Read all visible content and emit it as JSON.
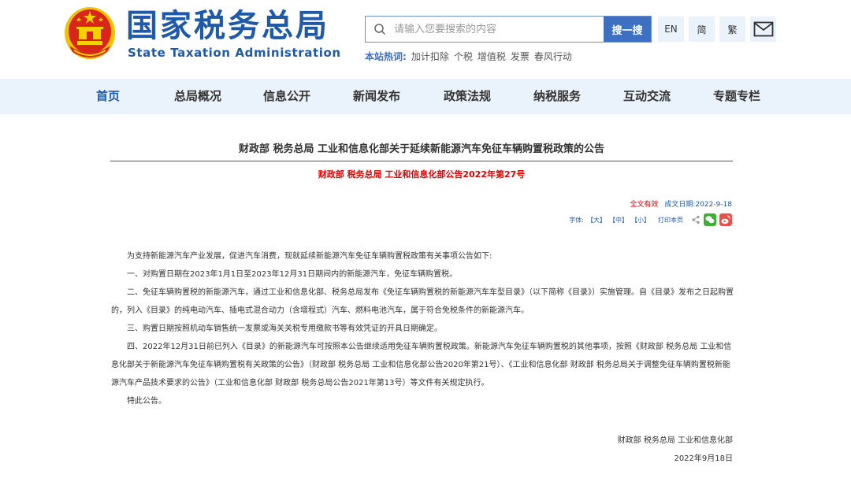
{
  "header": {
    "logo_cn": "国家税务总局",
    "logo_en": "State Taxation Administration",
    "search_placeholder": "请输入您要搜索的内容",
    "search_button": "搜一搜",
    "lang_en": "EN",
    "lang_simplified": "简",
    "lang_traditional": "繁",
    "hot_label": "本站热词:",
    "hot_words": [
      "加计扣除",
      "个税",
      "增值税",
      "发票",
      "春风行动"
    ]
  },
  "nav": {
    "items": [
      "首页",
      "总局概况",
      "信息公开",
      "新闻发布",
      "政策法规",
      "纳税服务",
      "互动交流",
      "专题专栏"
    ],
    "active": "首页"
  },
  "article": {
    "title": "财政部 税务总局 工业和信息化部关于延续新能源汽车免征车辆购置税政策的公告",
    "doc_number": "财政部 税务总局 工业和信息化部公告2022年第27号",
    "validity": "全文有效",
    "date_label": "成文日期:2022-9-18",
    "tools": {
      "font_label": "字体:",
      "font_large": "【大】",
      "font_medium": "【中】",
      "font_small": "【小】",
      "print": "打印本页"
    },
    "paragraphs": [
      "为支持新能源汽车产业发展，促进汽车消费，现就延续新能源汽车免征车辆购置税政策有关事项公告如下:",
      "一、对购置日期在2023年1月1日至2023年12月31日期间内的新能源汽车，免征车辆购置税。",
      "二、免征车辆购置税的新能源汽车，通过工业和信息化部、税务总局发布《免征车辆购置税的新能源汽车车型目录》（以下简称《目录》）实施管理。自《目录》发布之日起购置的，列入《目录》的纯电动汽车、插电式混合动力（含增程式）汽车、燃料电池汽车，属于符合免税条件的新能源汽车。",
      "三、购置日期按照机动车销售统一发票或海关关税专用缴款书等有效凭证的开具日期确定。",
      "四、2022年12月31日前已列入《目录》的新能源汽车可按照本公告继续适用免征车辆购置税政策。新能源汽车免征车辆购置税的其他事项，按照《财政部 税务总局 工业和信息化部关于新能源汽车免征车辆购置税有关政策的公告》（财政部 税务总局 工业和信息化部公告2020年第21号）、《工业和信息化部 财政部 税务总局关于调整免征车辆购置税新能源汽车产品技术要求的公告》（工业和信息化部 财政部 税务总局公告2021年第13号）等文件有关规定执行。",
      "特此公告。"
    ],
    "signer": "财政部  税务总局  工业和信息化部",
    "sign_date": "2022年9月18日"
  },
  "colors": {
    "brand_blue": "#1f5aa8",
    "nav_bg": "#eaf2fb",
    "button_blue": "#3d70c0",
    "red": "#dd0000"
  }
}
